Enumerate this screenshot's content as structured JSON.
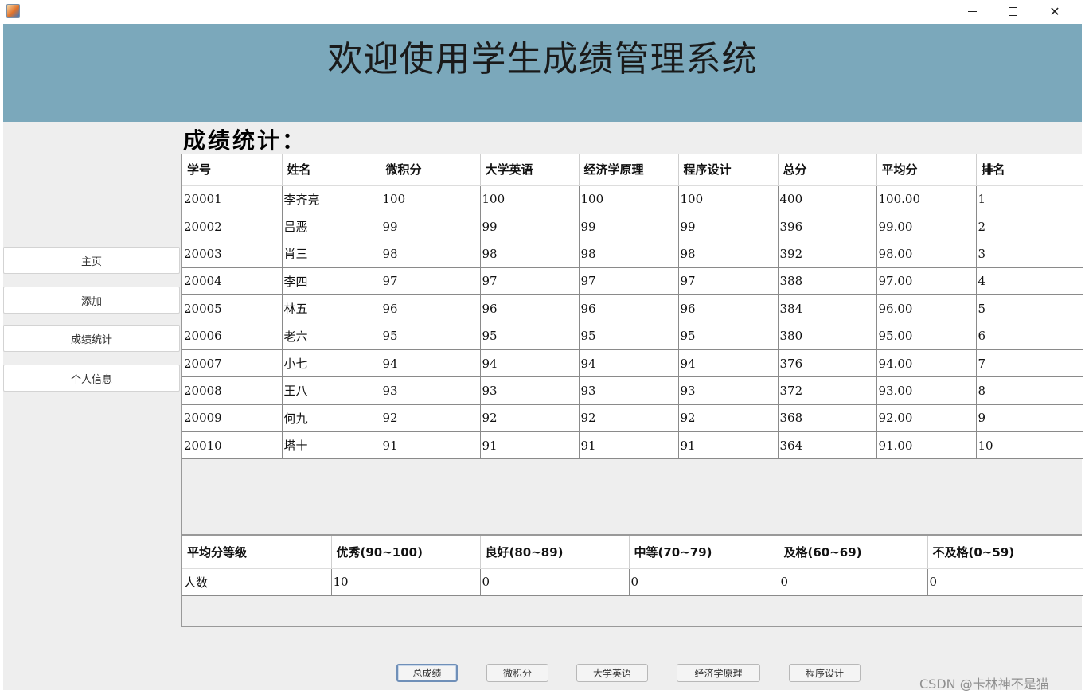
{
  "window": {
    "icon": "java-icon",
    "controls": [
      "minimize-icon",
      "maximize-icon",
      "close-icon"
    ],
    "close_glyph": "✕"
  },
  "header": {
    "title": "欢迎使用学生成绩管理系统",
    "background": "#7ba8bb"
  },
  "sidebar": {
    "items": [
      {
        "label": "主页"
      },
      {
        "label": "添加"
      },
      {
        "label": "成绩统计"
      },
      {
        "label": "个人信息"
      }
    ]
  },
  "section_title": "成绩统计：",
  "scores_table": {
    "columns": [
      "学号",
      "姓名",
      "微积分",
      "大学英语",
      "经济学原理",
      "程序设计",
      "总分",
      "平均分",
      "排名"
    ],
    "rows": [
      [
        "20001",
        "李齐亮",
        "100",
        "100",
        "100",
        "100",
        "400",
        "100.00",
        "1"
      ],
      [
        "20002",
        "吕恶",
        "99",
        "99",
        "99",
        "99",
        "396",
        "99.00",
        "2"
      ],
      [
        "20003",
        "肖三",
        "98",
        "98",
        "98",
        "98",
        "392",
        "98.00",
        "3"
      ],
      [
        "20004",
        "李四",
        "97",
        "97",
        "97",
        "97",
        "388",
        "97.00",
        "4"
      ],
      [
        "20005",
        "林五",
        "96",
        "96",
        "96",
        "96",
        "384",
        "96.00",
        "5"
      ],
      [
        "20006",
        "老六",
        "95",
        "95",
        "95",
        "95",
        "380",
        "95.00",
        "6"
      ],
      [
        "20007",
        "小七",
        "94",
        "94",
        "94",
        "94",
        "376",
        "94.00",
        "7"
      ],
      [
        "20008",
        "王八",
        "93",
        "93",
        "93",
        "93",
        "372",
        "93.00",
        "8"
      ],
      [
        "20009",
        "何九",
        "92",
        "92",
        "92",
        "92",
        "368",
        "92.00",
        "9"
      ],
      [
        "20010",
        "塔十",
        "91",
        "91",
        "91",
        "91",
        "364",
        "91.00",
        "10"
      ]
    ]
  },
  "grade_table": {
    "columns": [
      "平均分等级",
      "优秀(90~100)",
      "良好(80~89)",
      "中等(70~79)",
      "及格(60~69)",
      "不及格(0~59)"
    ],
    "rows": [
      [
        "人数",
        "10",
        "0",
        "0",
        "0",
        "0"
      ]
    ]
  },
  "bottom_buttons": [
    {
      "label": "总成绩",
      "active": true
    },
    {
      "label": "微积分",
      "active": false
    },
    {
      "label": "大学英语",
      "active": false
    },
    {
      "label": "经济学原理",
      "active": false
    },
    {
      "label": "程序设计",
      "active": false
    }
  ],
  "watermark": "CSDN @卡林神不是猫"
}
